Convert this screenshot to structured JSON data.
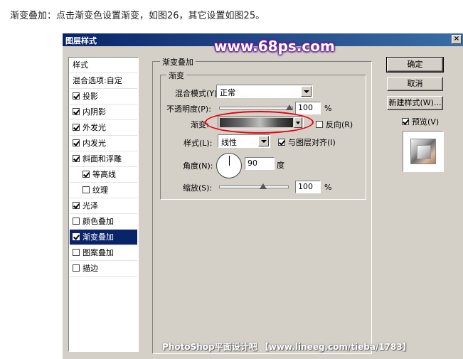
{
  "intro_text": "渐变叠加：点击渐变色设置渐变，如图26，其它设置如图25。",
  "dialog": {
    "title": "图层样式",
    "close_glyph": "×"
  },
  "watermark_top": "www.68ps.com",
  "watermark_bottom": "PhotoShop平面设计吧 【www.lineeg.com/tieba/1783】",
  "style_list": {
    "header": "样式",
    "blend_options": "混合选项:自定",
    "items": [
      {
        "label": "投影",
        "checked": true
      },
      {
        "label": "内阴影",
        "checked": true
      },
      {
        "label": "外发光",
        "checked": true
      },
      {
        "label": "内发光",
        "checked": true
      },
      {
        "label": "斜面和浮雕",
        "checked": true
      },
      {
        "label": "等高线",
        "checked": true
      },
      {
        "label": "纹理",
        "checked": false
      },
      {
        "label": "光泽",
        "checked": true
      },
      {
        "label": "颜色叠加",
        "checked": false
      },
      {
        "label": "渐变叠加",
        "checked": true
      },
      {
        "label": "图案叠加",
        "checked": false
      },
      {
        "label": "描边",
        "checked": false
      }
    ]
  },
  "panel": {
    "outer_title": "渐变叠加",
    "inner_title": "渐变",
    "blend_mode_label": "混合模式(Y):",
    "blend_mode_value": "正常",
    "opacity_label": "不透明度(P):",
    "opacity_value": "100",
    "opacity_unit": "%",
    "gradient_label": "渐变:",
    "reverse_label": "反向(R)",
    "reverse_checked": false,
    "style_label": "样式(L):",
    "style_value": "线性",
    "align_label": "与图层对齐(I)",
    "align_checked": true,
    "angle_label": "角度(N):",
    "angle_value": "90",
    "angle_unit": "度",
    "scale_label": "缩放(S):",
    "scale_value": "100",
    "scale_unit": "%"
  },
  "buttons": {
    "ok": "确定",
    "cancel": "取消",
    "new_style": "新建样式(W)...",
    "preview_label": "预览(V)",
    "preview_checked": true
  },
  "colors": {
    "highlight": "#e60012",
    "selection": "#0a246a",
    "dialog_bg": "#d4d0c8"
  }
}
